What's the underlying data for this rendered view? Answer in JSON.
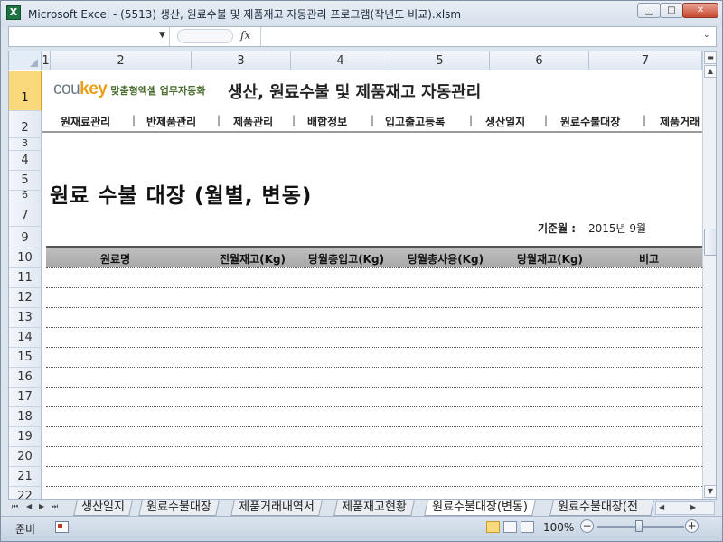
{
  "window": {
    "title": "Microsoft Excel - (5513) 생산, 원료수불 및 제품재고 자동관리 프로그램(작년도 비교).xlsm",
    "app_icon": "excel-icon",
    "min_label": "▁",
    "max_label": "□",
    "close_label": "✕"
  },
  "formula_bar": {
    "name_box": "",
    "fx_label": "fx",
    "content": ""
  },
  "columns": [
    "1",
    "2",
    "3",
    "4",
    "5",
    "6",
    "7"
  ],
  "rows": [
    "1",
    "2",
    "3",
    "4",
    "5",
    "6",
    "7",
    "9",
    "10",
    "11",
    "12",
    "13",
    "14",
    "15",
    "16",
    "17",
    "18",
    "19",
    "20",
    "21",
    "22"
  ],
  "sheet": {
    "brand_logo_prefix": "cou",
    "brand_logo_suffix": "key",
    "brand_sub": "맞춤형엑셀 업무자동화",
    "brand_title": "생산, 원료수불 및 제품재고 자동관리",
    "nav": [
      "원재료관리",
      "반제품관리",
      "제품관리",
      "배합정보",
      "입고출고등록",
      "생산일지",
      "원료수불대장",
      "제품거래"
    ],
    "nav_sep": "|",
    "title": "원료 수불 대장 (월별, 변동)",
    "base_month_label": "기준월 :",
    "base_month_value": "2015년  9월",
    "table_headers": [
      "원료명",
      "전월재고(Kg)",
      "당월총입고(Kg)",
      "당월총사용(Kg)",
      "당월재고(Kg)",
      "비고"
    ]
  },
  "tabs": {
    "nav_first": "⏮",
    "nav_prev": "◀",
    "nav_next": "▶",
    "nav_last": "⏭",
    "items": [
      "생산일지",
      "원료수불대장",
      "제품거래내역서",
      "제품재고현황",
      "원료수불대장(변동)",
      "원료수불대장(전"
    ],
    "active_index": 4
  },
  "status": {
    "ready": "준비",
    "zoom": "100%",
    "zoom_minus": "−",
    "zoom_plus": "+",
    "zoom_level_percent": 100
  },
  "colors": {
    "selected_row_header": "#f9d97b",
    "table_header_bg": "#b0b0b0",
    "brand_accent": "#e8a01a"
  }
}
